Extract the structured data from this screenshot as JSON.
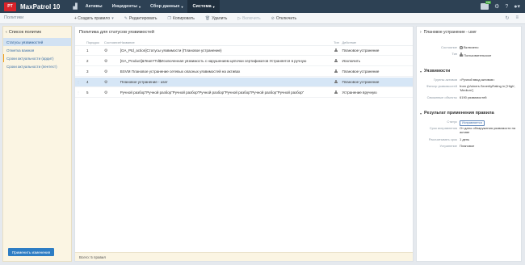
{
  "app": {
    "logo": "PT",
    "title": "MaxPatrol 10",
    "nav": [
      {
        "label": "Активы",
        "has_menu": false
      },
      {
        "label": "Инциденты",
        "has_menu": true
      },
      {
        "label": "Сбор данных",
        "has_menu": true
      },
      {
        "label": "Система",
        "has_menu": true,
        "active": true
      }
    ],
    "badge": "999",
    "icons": [
      "chart-icon",
      "notifications-icon",
      "settings-icon",
      "help-icon",
      "user-icon"
    ]
  },
  "subbar": {
    "section_title": "Политики",
    "toolbar": [
      {
        "label": "+ Создать правило",
        "has_menu": true,
        "icon": "plus-icon",
        "enabled": true
      },
      {
        "label": "Редактировать",
        "icon": "pencil-icon",
        "enabled": true
      },
      {
        "label": "Копировать",
        "icon": "copy-icon",
        "enabled": true
      },
      {
        "label": "Удалить",
        "icon": "trash-icon",
        "enabled": true
      },
      {
        "label": "Включить",
        "icon": "play-icon",
        "enabled": false
      },
      {
        "label": "Отключить",
        "icon": "stop-icon",
        "enabled": true
      }
    ],
    "right_icons": [
      "refresh-icon",
      "menu-icon"
    ]
  },
  "left": {
    "header": "Список политик",
    "items": [
      {
        "label": "Статусы уязвимостей",
        "active": true
      },
      {
        "label": "Отметка важная",
        "active": false
      },
      {
        "label": "Сроки актуальности (ардит)",
        "active": false,
        "marked": true
      },
      {
        "label": "Сроки актуальности (пентест)",
        "active": false
      }
    ],
    "apply_button": "Применить изменения"
  },
  "center": {
    "title": "Политика для статусов уязвимостей",
    "columns": {
      "order": "Порядок",
      "state": "Состояние",
      "name": "Название",
      "ext": "Тип",
      "action": "Действие"
    },
    "rows": [
      {
        "order": "1",
        "name": "[GA_Ptd_action]Статусы уязвимости (Плановое устранение)",
        "action": "Плановое устранение",
        "selected": false
      },
      {
        "order": "2",
        "name": "[GA_Product]&Team*Td$Исключенная уязвимость с нарушением цепочки сертификатов Устраняется в ручную",
        "action": "Исключить",
        "selected": false
      },
      {
        "order": "3",
        "name": "BSVM Плановое устранение сетевых опасных уязвимостей на активах",
        "action": "Плановое устранение",
        "selected": false
      },
      {
        "order": "4",
        "name": "Плановое устранение - user",
        "action": "Плановое устранение",
        "selected": true
      },
      {
        "order": "5",
        "name": "Ручной разбор\"Ручной разбор\"Ручной разбор\"Ручной разбор\"Ручной разбор\"Ручной разбор\"Ручной разбор\"",
        "action": "Устранение вручную",
        "selected": false
      }
    ],
    "footer": "Всего: 5 правил"
  },
  "right": {
    "title": "Плановое устранение - user",
    "general": [
      {
        "key": "Состояние",
        "value": "Включено"
      },
      {
        "key": "Тип",
        "value": "Пользовательское"
      }
    ],
    "vuln_section": "Уязвимости",
    "vuln": [
      {
        "key": "Группы активов",
        "value": "=Ручной ввод активов="
      },
      {
        "key": "Фильтр уязвимостей",
        "value": "from gVulners.SeverityRating in ['High', 'Medium']"
      },
      {
        "key": "Связанные объекты",
        "value": "6190 уязвимостей"
      }
    ],
    "result_section": "Результат применения правила",
    "result": [
      {
        "key": "Статус",
        "value": "Исправляется"
      },
      {
        "key": "Срок исправления",
        "value": "От даты обнаружения уязвимости на активе"
      },
      {
        "key": "Рассчитывать срок",
        "value": "1 день"
      },
      {
        "key": "Устранение",
        "value": "Плановое"
      }
    ]
  }
}
